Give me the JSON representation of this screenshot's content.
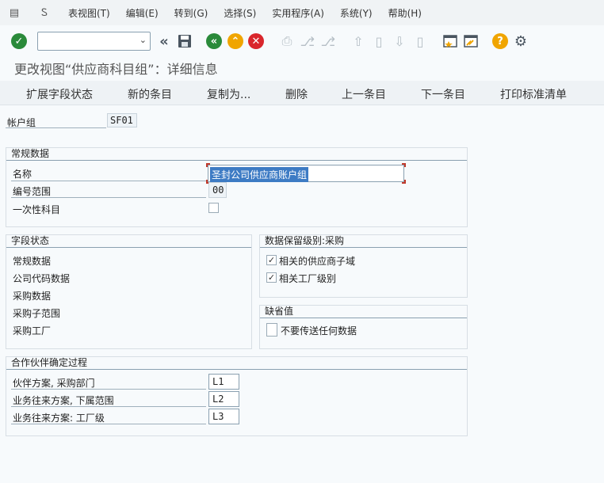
{
  "menubar": {
    "items": [
      "表视图(T)",
      "编辑(E)",
      "转到(G)",
      "选择(S)",
      "实用程序(A)",
      "系统(Y)",
      "帮助(H)"
    ]
  },
  "toolbar": {
    "command_value": "",
    "icons": [
      "check-icon",
      "back-double-icon",
      "save-icon",
      "back-icon",
      "exit-icon",
      "cancel-icon",
      "print-icon",
      "find-icon",
      "find-next-icon",
      "first-page-icon",
      "prev-page-icon",
      "next-page-icon",
      "last-page-icon",
      "new-session-icon",
      "shortcut-icon",
      "help-icon",
      "settings-icon"
    ]
  },
  "title": "更改视图“供应商科目组”：详细信息",
  "actions": [
    "扩展字段状态",
    "新的条目",
    "复制为...",
    "删除",
    "上一条目",
    "下一条目",
    "打印标准清单"
  ],
  "account_group": {
    "label": "帐户组",
    "value": "SF01"
  },
  "general": {
    "title": "常规数据",
    "name_label": "名称",
    "name_value": "圣封公司供应商账户组",
    "number_range_label": "编号范围",
    "number_range_value": "00",
    "one_time_label": "一次性科目",
    "one_time_checked": false
  },
  "field_status": {
    "title": "字段状态",
    "items": [
      "常规数据",
      "公司代码数据",
      "采购数据",
      "采购子范围",
      "采购工厂"
    ]
  },
  "retention": {
    "title": "数据保留级别:采购",
    "items": [
      {
        "label": "相关的供应商子域",
        "checked": true
      },
      {
        "label": "相关工厂级别",
        "checked": true
      }
    ]
  },
  "defaults": {
    "title": "缺省值",
    "item_label": "不要传送任何数据",
    "checked": false
  },
  "partner": {
    "title": "合作伙伴确定过程",
    "rows": [
      {
        "label": "伙伴方案, 采购部门",
        "value": "L1"
      },
      {
        "label": "业务往来方案, 下属范围",
        "value": "L2"
      },
      {
        "label": "业务往来方案: 工厂级",
        "value": "L3"
      }
    ]
  },
  "colors": {
    "ok_green": "#2a8a3a",
    "nav_green": "#2a8a3a",
    "exit_orange": "#f0a500",
    "cancel_red": "#d9262c",
    "help_yellow": "#f0a500",
    "selection_blue": "#3d7bc4"
  }
}
